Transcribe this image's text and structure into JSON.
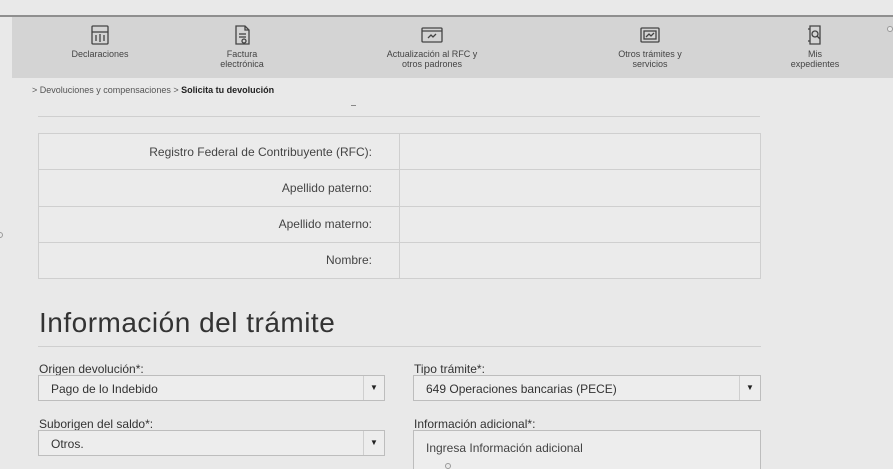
{
  "nav": {
    "items": [
      {
        "label": "Declaraciones",
        "icon": "calculator-icon"
      },
      {
        "label": "Factura\nelectrónica",
        "icon": "invoice-icon"
      },
      {
        "label": "Actualización al RFC y\notros padrones",
        "icon": "rfc-update-icon"
      },
      {
        "label": "Otros trámites y\nservicios",
        "icon": "services-icon"
      },
      {
        "label": "Mis\nexpedientes",
        "icon": "folder-icon"
      }
    ]
  },
  "breadcrumb": {
    "prefix": "> Devoluciones y compensaciones > ",
    "current": "Solicita tu devolución"
  },
  "taxpayer": {
    "rows": [
      {
        "label": "Registro Federal de Contribuyente (RFC):",
        "value": ""
      },
      {
        "label": "Apellido paterno:",
        "value": ""
      },
      {
        "label": "Apellido materno:",
        "value": ""
      },
      {
        "label": "Nombre:",
        "value": ""
      }
    ]
  },
  "tramite": {
    "title": "Información del trámite",
    "origen_label": "Origen devolución*:",
    "origen_value": "Pago de lo Indebido",
    "tipo_label": "Tipo trámite*:",
    "tipo_value": "649 Operaciones bancarias (PECE)",
    "suborigen_label": "Suborigen del saldo*:",
    "suborigen_value": "Otros.",
    "info_label": "Información adicional*:",
    "info_placeholder": "Ingresa Información adicional"
  },
  "colors": {
    "background": "#e9e9e9",
    "navbar": "#d4d4d4",
    "border": "#cfcfcf"
  }
}
